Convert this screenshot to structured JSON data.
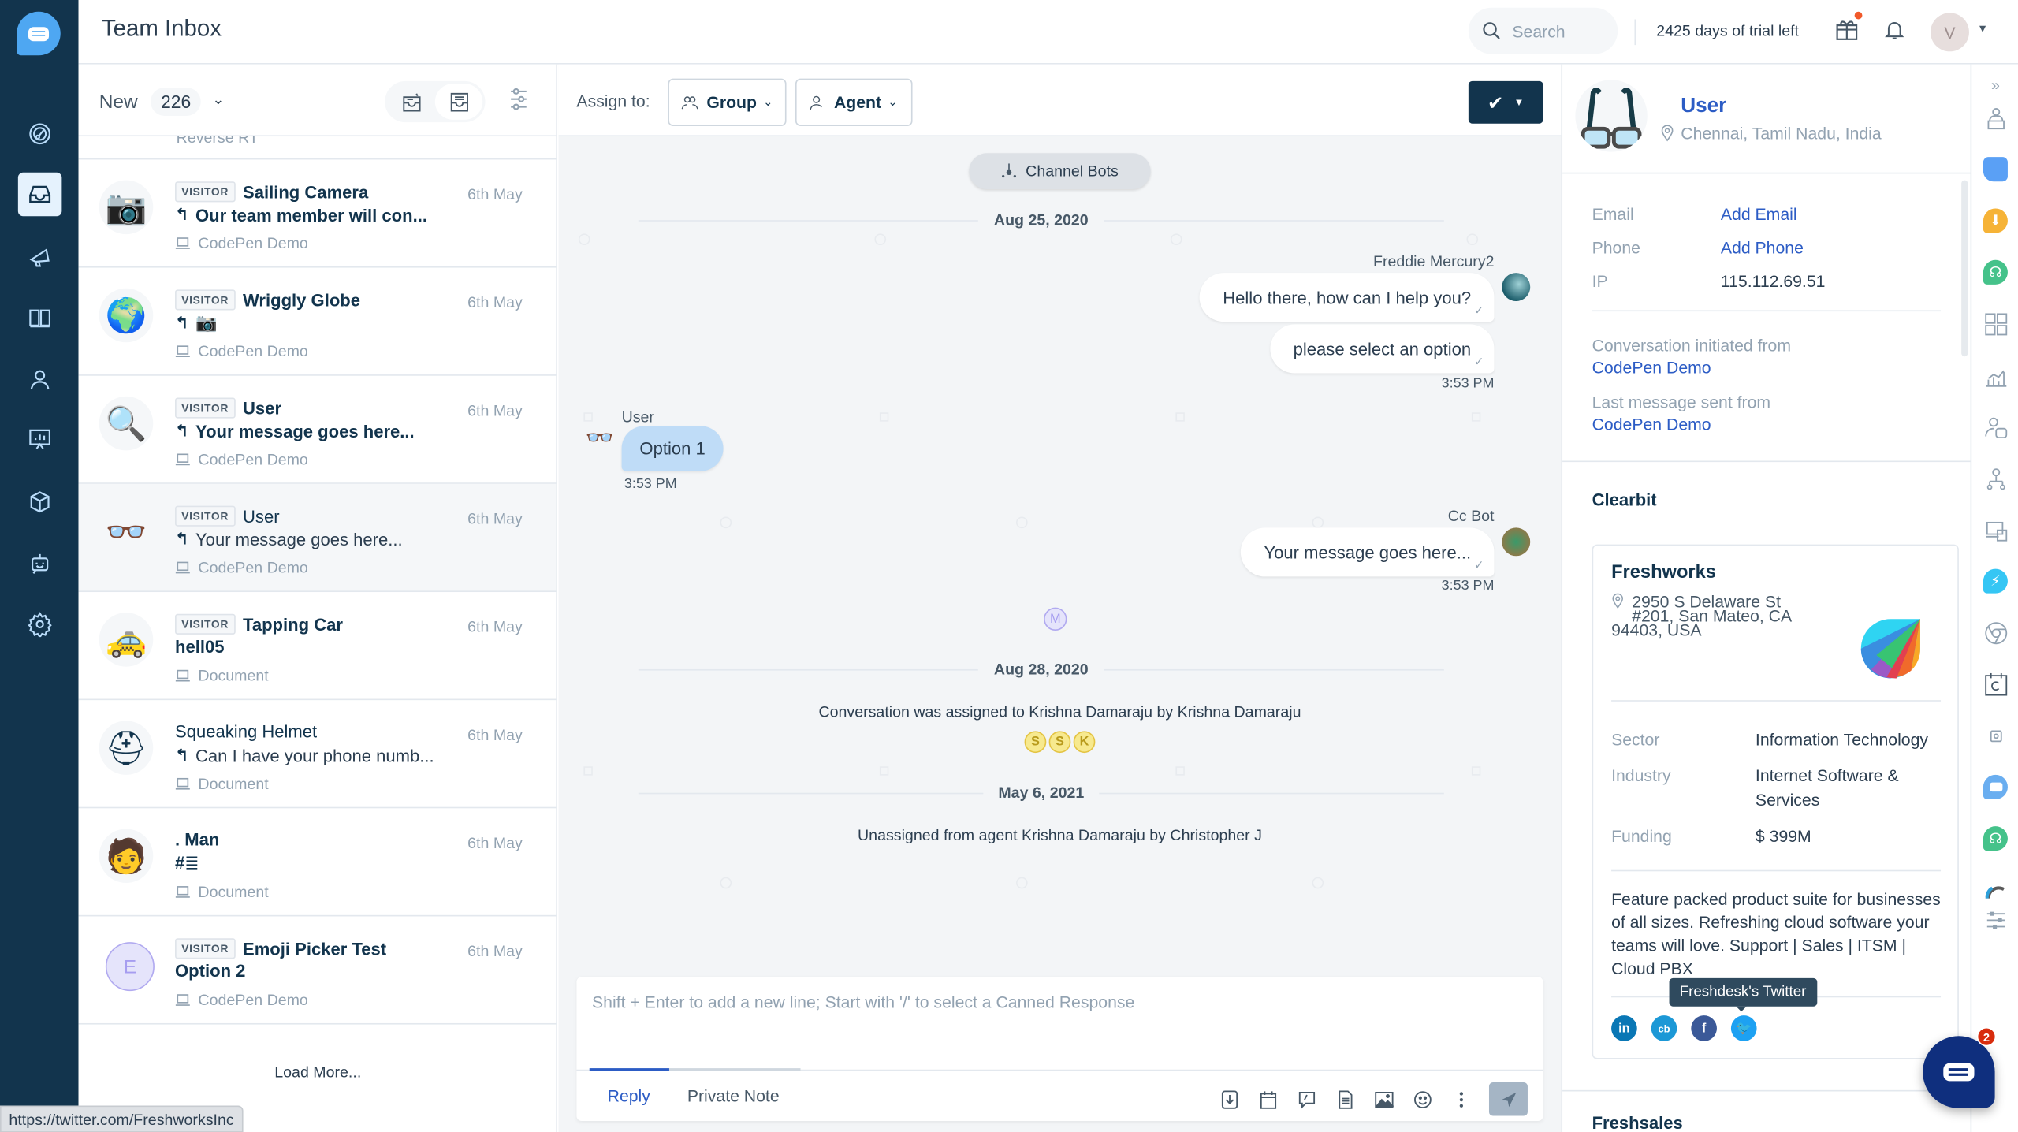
{
  "app": {
    "title": "Team Inbox",
    "search_placeholder": "Search",
    "trial_text": "2425 days of trial left",
    "user_initial": "V",
    "colors": {
      "nav_bg": "#12344d",
      "accent": "#2c5cc5",
      "brand_blue": "#4ea7f2",
      "fab": "#0f2f7e",
      "notification": "#d82c0d"
    }
  },
  "nav": {
    "items": [
      {
        "icon": "dashboard-icon",
        "label": "Dashboard"
      },
      {
        "icon": "inbox-icon",
        "label": "Team Inbox",
        "active": true
      },
      {
        "icon": "megaphone-icon",
        "label": "Campaigns"
      },
      {
        "icon": "book-icon",
        "label": "Solutions"
      },
      {
        "icon": "contact-icon",
        "label": "Contacts"
      },
      {
        "icon": "reports-icon",
        "label": "Reports"
      },
      {
        "icon": "apps-icon",
        "label": "Apps"
      },
      {
        "icon": "bot-icon",
        "label": "Bots"
      },
      {
        "icon": "settings-icon",
        "label": "Settings"
      }
    ]
  },
  "list": {
    "filter_label": "New",
    "count": "226",
    "partial_item_source": "Reverse RT",
    "load_more": "Load More...",
    "items": [
      {
        "avatar": "📷",
        "visitor": true,
        "visitor_label": "VISITOR",
        "name": "Sailing Camera",
        "name_bold": true,
        "date": "6th May",
        "reply": true,
        "message": "Our team member will con...",
        "message_bold": true,
        "source": "CodePen Demo"
      },
      {
        "avatar": "🌍",
        "visitor": true,
        "visitor_label": "VISITOR",
        "name": "Wriggly Globe",
        "name_bold": true,
        "date": "6th May",
        "reply": true,
        "message": "📷",
        "message_bold": true,
        "source": "CodePen Demo"
      },
      {
        "avatar": "🔍",
        "visitor": true,
        "visitor_label": "VISITOR",
        "name": "User",
        "name_bold": true,
        "date": "6th May",
        "reply": true,
        "message": "Your message goes here...",
        "message_bold": true,
        "source": "CodePen Demo"
      },
      {
        "avatar": "👓",
        "visitor": true,
        "visitor_label": "VISITOR",
        "name": "User",
        "name_bold": false,
        "date": "6th May",
        "reply": true,
        "message": "Your message goes here...",
        "message_bold": false,
        "source": "CodePen Demo",
        "selected": true
      },
      {
        "avatar": "🚕",
        "visitor": true,
        "visitor_label": "VISITOR",
        "name": "Tapping Car",
        "name_bold": true,
        "date": "6th May",
        "reply": false,
        "message": "hell05",
        "message_bold": true,
        "source": "Document"
      },
      {
        "avatar": "⛑",
        "visitor": false,
        "name": "Squeaking Helmet",
        "name_bold": false,
        "date": "6th May",
        "reply": true,
        "message": "Can I have your phone numb...",
        "message_bold": false,
        "source": "Document"
      },
      {
        "avatar": "🧑",
        "visitor": false,
        "name": ". Man",
        "name_bold": true,
        "date": "6th May",
        "reply": false,
        "message": "#≣",
        "message_bold": true,
        "source": "Document"
      },
      {
        "avatar": "E",
        "avatar_letter": true,
        "visitor": true,
        "visitor_label": "VISITOR",
        "name": "Emoji Picker Test",
        "name_bold": true,
        "date": "6th May",
        "reply": false,
        "message": "Option 2",
        "message_bold": true,
        "source": "CodePen Demo"
      }
    ]
  },
  "status_url": "https://twitter.com/FreshworksInc",
  "conversation": {
    "assign_label": "Assign to:",
    "group_label": "Group",
    "agent_label": "Agent",
    "channel_bots": "Channel Bots",
    "date1": "Aug 25, 2020",
    "agent1_name": "Freddie Mercury2",
    "msg1": "Hello there, how can I help you?",
    "msg2": "please select an option",
    "time1": "3:53 PM",
    "user_name": "User",
    "user_msg": "Option 1",
    "time2": "3:53 PM",
    "agent2_name": "Cc Bot",
    "msg3": "Your message goes here...",
    "time3": "3:53 PM",
    "typing_avatar": "M",
    "date2": "Aug 28, 2020",
    "sys1": "Conversation was assigned to Krishna Damaraju by Krishna Damaraju",
    "seen_by": [
      "S",
      "S",
      "K"
    ],
    "date3": "May 6, 2021",
    "sys2": "Unassigned from agent Krishna Damaraju by Christopher J"
  },
  "composer": {
    "placeholder": "Shift + Enter to add a new line; Start with '/' to select a Canned Response",
    "tab_reply": "Reply",
    "tab_note": "Private Note"
  },
  "contact": {
    "name": "User",
    "location": "Chennai, Tamil Nadu, India",
    "email_label": "Email",
    "email_value": "Add Email",
    "phone_label": "Phone",
    "phone_value": "Add Phone",
    "ip_label": "IP",
    "ip_value": "115.112.69.51",
    "initiated_label": "Conversation initiated from",
    "initiated_value": "CodePen Demo",
    "last_label": "Last message sent from",
    "last_value": "CodePen Demo",
    "clearbit_title": "Clearbit",
    "company": {
      "name": "Freshworks",
      "address_line1": "2950 S Delaware St",
      "address_line2": "#201, San Mateo, CA",
      "address_line3": "94403, USA",
      "sector_label": "Sector",
      "sector": "Information Technology",
      "industry_label": "Industry",
      "industry": "Internet Software & Services",
      "funding_label": "Funding",
      "funding": "$ 399M",
      "description": "Feature packed product suite for businesses of all sizes. Refreshing cloud software your teams will love. Support | Sales | ITSM | Cloud PBX",
      "socials": [
        "linkedin",
        "crunchbase",
        "facebook",
        "twitter"
      ]
    },
    "tooltip": "Freshdesk's Twitter",
    "freshsales_title": "Freshsales"
  },
  "fab_badge": "2"
}
